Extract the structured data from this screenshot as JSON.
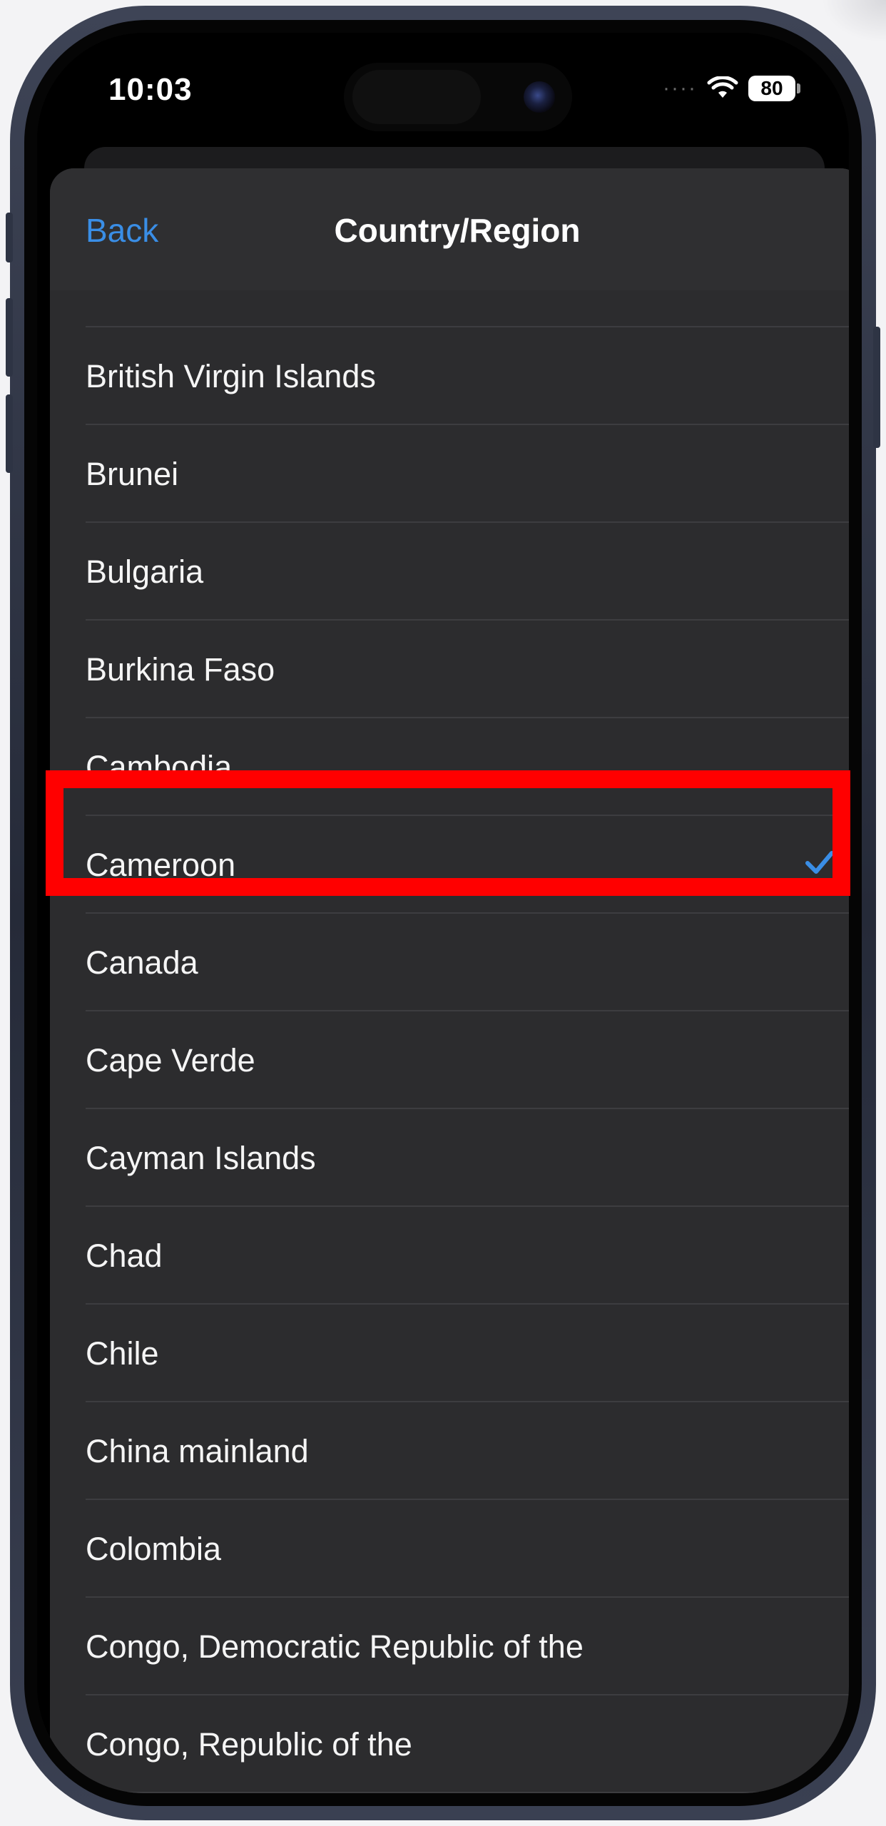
{
  "status_bar": {
    "time": "10:03",
    "signal": "····",
    "battery": "80"
  },
  "nav": {
    "back_label": "Back",
    "title": "Country/Region"
  },
  "list": {
    "items": [
      {
        "label": "British Virgin Islands",
        "selected": false
      },
      {
        "label": "Brunei",
        "selected": false
      },
      {
        "label": "Bulgaria",
        "selected": false
      },
      {
        "label": "Burkina Faso",
        "selected": false
      },
      {
        "label": "Cambodia",
        "selected": false
      },
      {
        "label": "Cameroon",
        "selected": true
      },
      {
        "label": "Canada",
        "selected": false
      },
      {
        "label": "Cape Verde",
        "selected": false
      },
      {
        "label": "Cayman Islands",
        "selected": false
      },
      {
        "label": "Chad",
        "selected": false
      },
      {
        "label": "Chile",
        "selected": false
      },
      {
        "label": "China mainland",
        "selected": false
      },
      {
        "label": "Colombia",
        "selected": false
      },
      {
        "label": "Congo, Democratic Republic of the",
        "selected": false
      },
      {
        "label": "Congo, Republic of the",
        "selected": false
      },
      {
        "label": "",
        "selected": false
      }
    ]
  },
  "colors": {
    "accent": "#3a8ee6",
    "highlight": "#ff0000",
    "sheet_background": "#2c2c2e"
  },
  "icons": {
    "checkmark": "checkmark-icon",
    "wifi": "wifi-icon",
    "battery": "battery-icon"
  }
}
